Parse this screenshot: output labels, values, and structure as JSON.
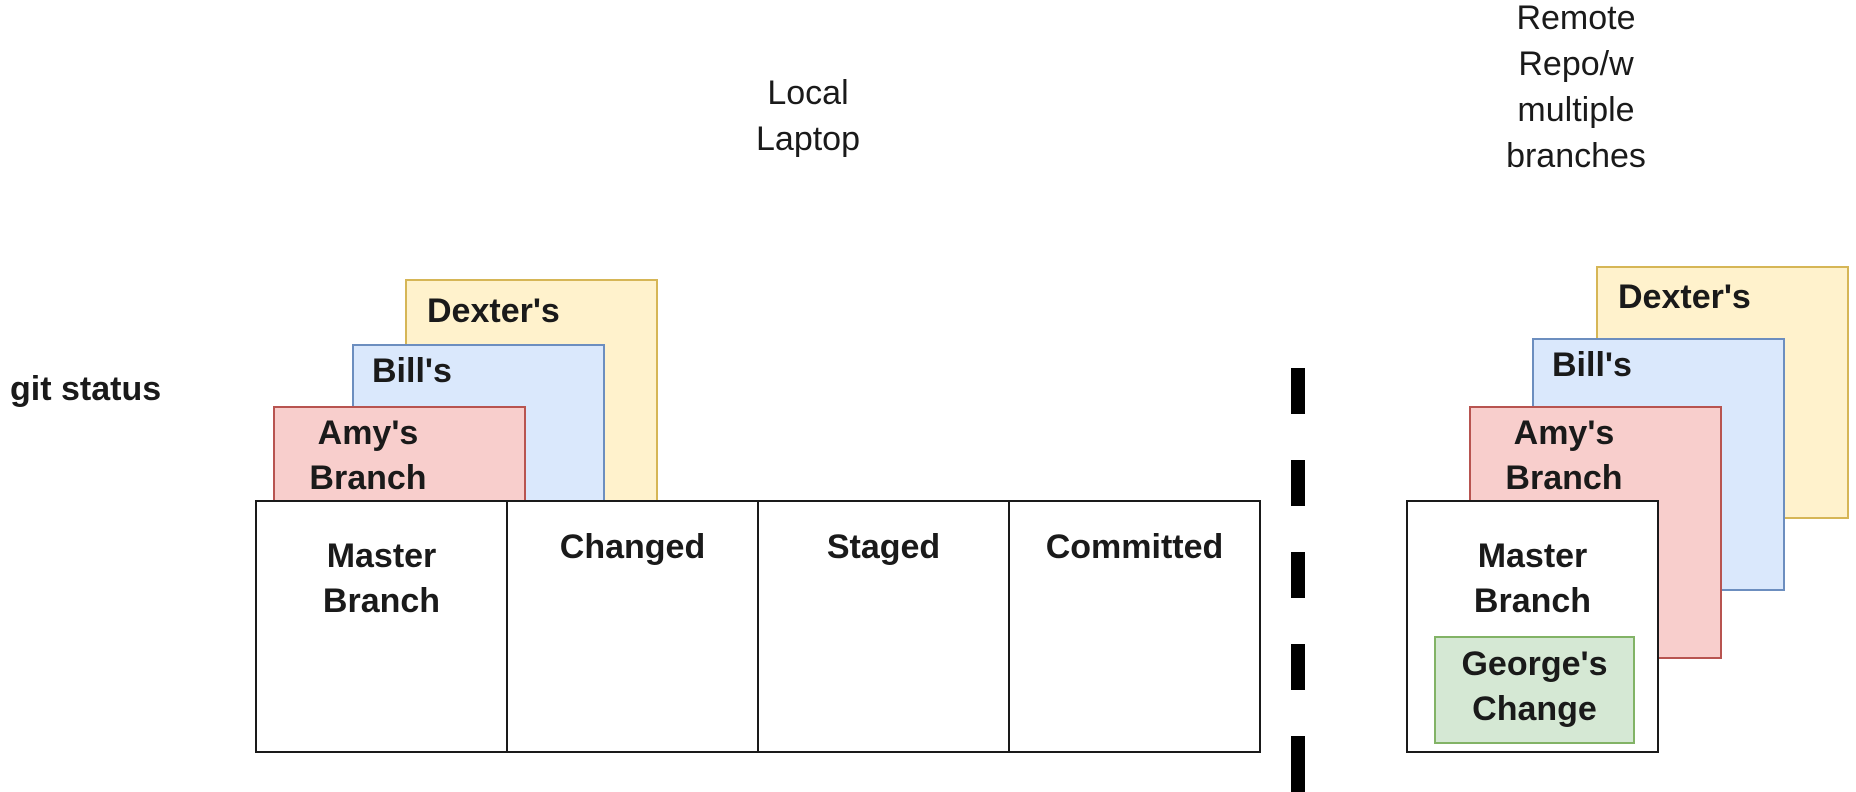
{
  "headers": {
    "local": "Local\nLaptop",
    "remote": "Remote\nRepo/w\nmultiple\nbranches"
  },
  "side_label": "git status",
  "local_branches": {
    "dexter": "Dexter's",
    "bill": "Bill's",
    "amy": "Amy's\nBranch"
  },
  "local_stages": {
    "master": "Master\nBranch",
    "changed": "Changed",
    "staged": "Staged",
    "committed": "Committed"
  },
  "remote_branches": {
    "dexter": "Dexter's",
    "bill": "Bill's",
    "amy": "Amy's\nBranch",
    "master": "Master\nBranch",
    "george": "George's\nChange"
  },
  "colors": {
    "yellow": "#fff2cc",
    "blue": "#dae8fc",
    "red": "#f8cecc",
    "green": "#d5e8d4"
  }
}
